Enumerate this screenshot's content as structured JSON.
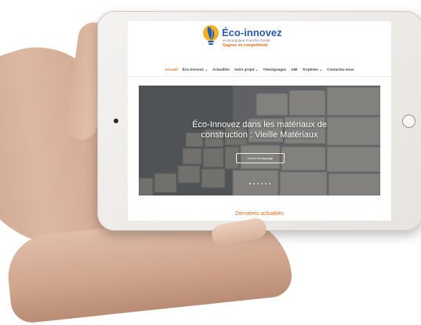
{
  "site": {
    "logo": {
      "icon": "lightbulb-leaf-logo",
      "title": "Éco-innovez",
      "subtitle": "en Bourgogne Franche-Comté",
      "tagline": "Gagnez en compétitivité"
    },
    "nav": {
      "items": [
        {
          "label": "Accueil",
          "active": true
        },
        {
          "label": "Éco-innovez",
          "dropdown": true
        },
        {
          "label": "Actualités"
        },
        {
          "label": "Votre projet",
          "dropdown": true
        },
        {
          "label": "Témoignages"
        },
        {
          "label": "AMI"
        },
        {
          "label": "Trophées",
          "dropdown": true
        },
        {
          "label": "Contactez-nous"
        }
      ]
    },
    "hero": {
      "title": "Éco-Innovez dans les matériaux de construction : Vieille Matériaux",
      "button_label": "voir le témoignage",
      "slides_count": 6,
      "active_slide": 0
    },
    "section": {
      "title": "Dernières actualités"
    },
    "colors": {
      "accent": "#e0701a",
      "brand_blue": "#2b5aa8"
    }
  }
}
